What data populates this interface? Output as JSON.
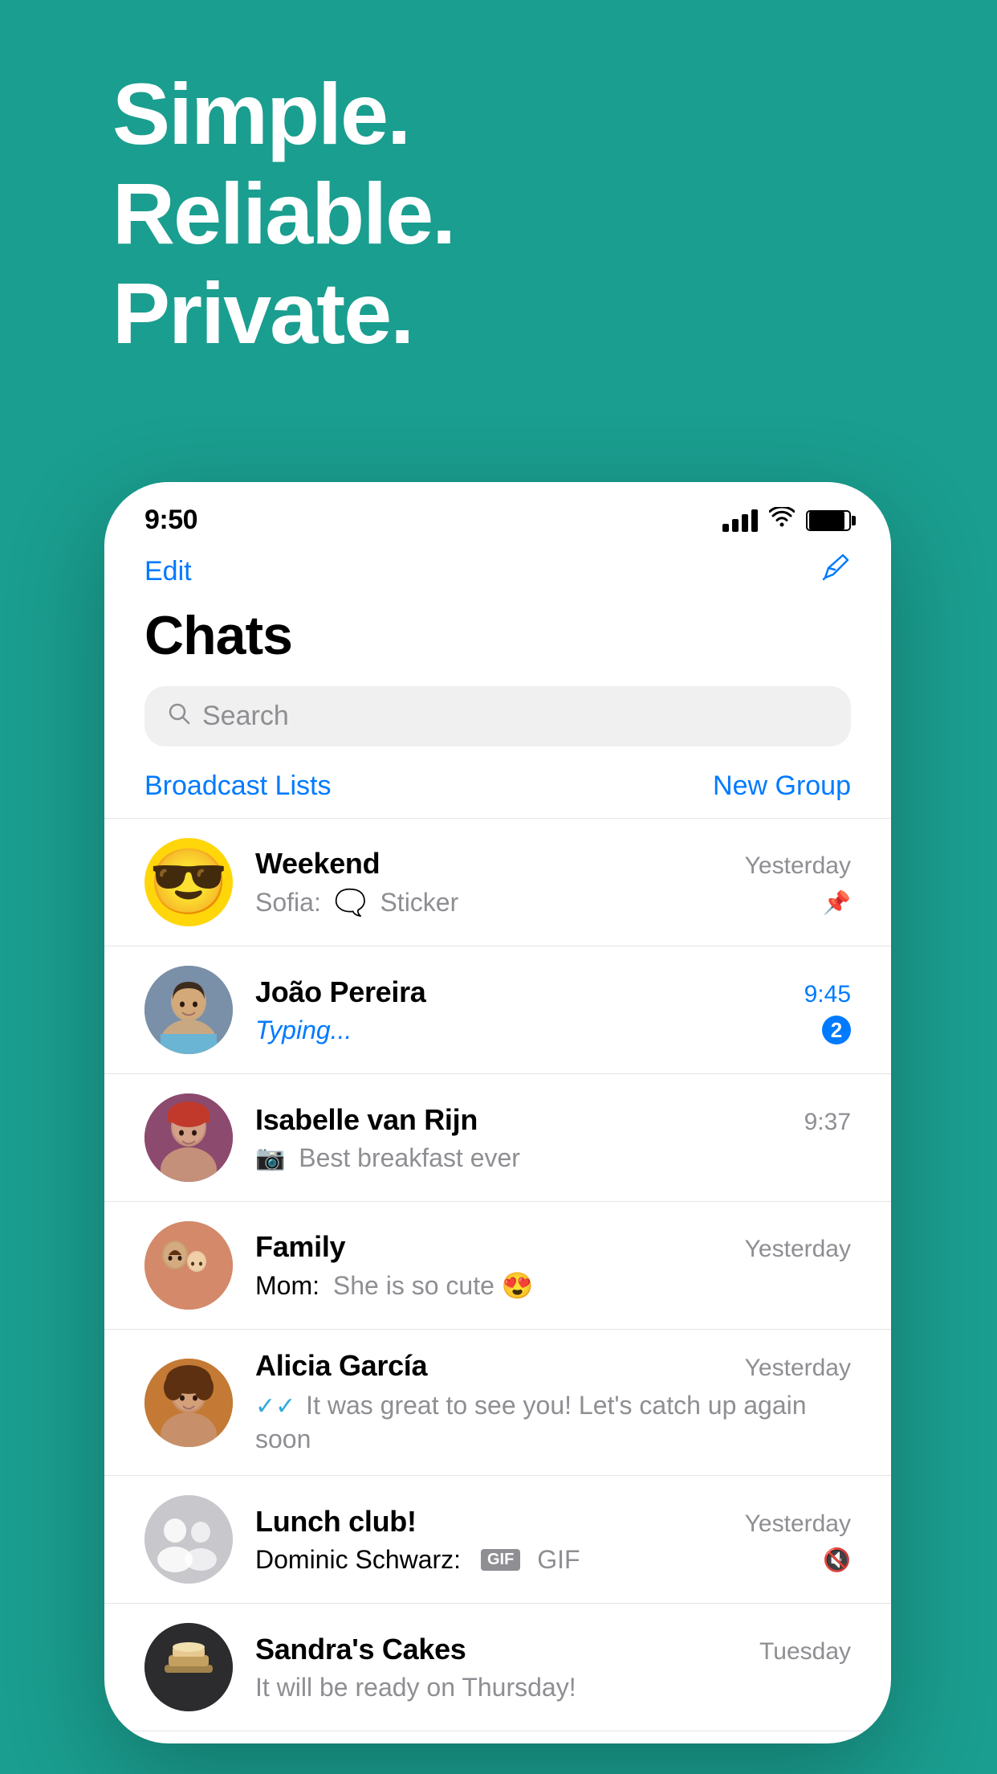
{
  "hero": {
    "line1": "Simple.",
    "line2": "Reliable.",
    "line3": "Private."
  },
  "statusBar": {
    "time": "9:50",
    "editLabel": "Edit",
    "composeSymbol": "✎"
  },
  "header": {
    "title": "Chats",
    "editLabel": "Edit"
  },
  "search": {
    "placeholder": "Search"
  },
  "actions": {
    "broadcastLabel": "Broadcast Lists",
    "newGroupLabel": "New Group"
  },
  "chats": [
    {
      "id": "weekend",
      "name": "Weekend",
      "preview": "Sofia:  Sticker",
      "time": "Yesterday",
      "timeBlue": false,
      "badge": "",
      "pinned": true,
      "muted": false,
      "avatarType": "emoji",
      "avatarEmoji": "😎",
      "previewType": "sticker",
      "previewSender": "Sofia: "
    },
    {
      "id": "joao",
      "name": "João Pereira",
      "preview": "Typing...",
      "time": "9:45",
      "timeBlue": true,
      "badge": "2",
      "pinned": false,
      "muted": false,
      "avatarType": "person-joao",
      "avatarEmoji": "",
      "previewType": "typing",
      "previewSender": ""
    },
    {
      "id": "isabelle",
      "name": "Isabelle van Rijn",
      "preview": "Best breakfast ever",
      "time": "9:37",
      "timeBlue": false,
      "badge": "",
      "pinned": false,
      "muted": false,
      "avatarType": "person-isabelle",
      "avatarEmoji": "",
      "previewType": "camera",
      "previewSender": ""
    },
    {
      "id": "family",
      "name": "Family",
      "preview": "Mom: She is so cute 😍",
      "time": "Yesterday",
      "timeBlue": false,
      "badge": "",
      "pinned": false,
      "muted": false,
      "avatarType": "person-family",
      "avatarEmoji": "",
      "previewType": "text",
      "previewSender": ""
    },
    {
      "id": "alicia",
      "name": "Alicia García",
      "preview": "It was great to see you! Let's catch up again soon",
      "time": "Yesterday",
      "timeBlue": false,
      "badge": "",
      "pinned": false,
      "muted": false,
      "avatarType": "person-alicia",
      "avatarEmoji": "",
      "previewType": "read",
      "previewSender": ""
    },
    {
      "id": "lunch",
      "name": "Lunch club!",
      "preview": "Dominic Schwarz:  GIF",
      "time": "Yesterday",
      "timeBlue": false,
      "badge": "",
      "pinned": false,
      "muted": true,
      "avatarType": "group",
      "avatarEmoji": "",
      "previewType": "gif",
      "previewSender": "Dominic Schwarz: "
    },
    {
      "id": "sandras",
      "name": "Sandra's Cakes",
      "preview": "It will be ready on Thursday!",
      "time": "Tuesday",
      "timeBlue": false,
      "badge": "",
      "pinned": false,
      "muted": false,
      "avatarType": "person-sandras",
      "avatarEmoji": "",
      "previewType": "text",
      "previewSender": ""
    }
  ]
}
